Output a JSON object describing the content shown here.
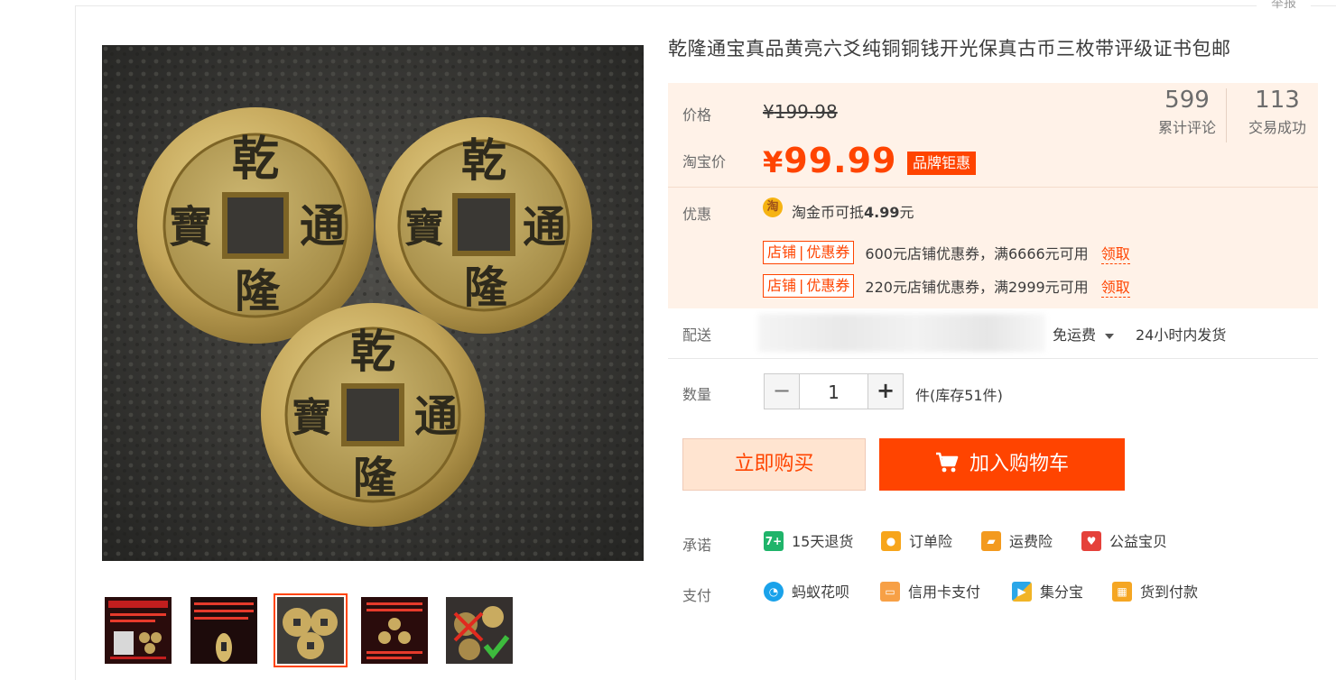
{
  "report_label": "举报",
  "product": {
    "title": "乾隆通宝真品黄亮六爻纯铜铜钱开光保真古币三枚带评级证书包邮",
    "coin_chars": {
      "top": "乾",
      "right": "通",
      "bottom": "隆",
      "left": "寶"
    }
  },
  "price": {
    "price_label": "价格",
    "original_price_yen": "¥",
    "original_price": "199.98",
    "taobao_label": "淘宝价",
    "taobao_price_yen": "¥",
    "taobao_price": "99.99",
    "brand_badge": "品牌钜惠",
    "reviews_count": "599",
    "reviews_label": "累计评论",
    "trades_count": "113",
    "trades_label": "交易成功"
  },
  "promo": {
    "label": "优惠",
    "gold_icon": "淘",
    "gold_text": "淘金币可抵",
    "gold_amount": "4.99",
    "gold_unit": "元",
    "coupons": [
      {
        "tag_a": "店铺",
        "tag_sep": "|",
        "tag_b": "优惠券",
        "text": "600元店铺优惠券，满6666元可用",
        "link": "领取"
      },
      {
        "tag_a": "店铺",
        "tag_sep": "|",
        "tag_b": "优惠券",
        "text": "220元店铺优惠券，满2999元可用",
        "link": "领取"
      }
    ]
  },
  "delivery": {
    "label": "配送",
    "free_shipping": "免运费",
    "ship_time": "24小时内发货"
  },
  "quantity": {
    "label": "数量",
    "minus": "−",
    "value": "1",
    "plus": "+",
    "stock": "件(库存51件)"
  },
  "actions": {
    "buy_now": "立即购买",
    "add_to_cart": "加入购物车"
  },
  "promises": {
    "label": "承诺",
    "items": [
      "15天退货",
      "订单险",
      "运费险",
      "公益宝贝"
    ]
  },
  "payment": {
    "label": "支付",
    "items": [
      "蚂蚁花呗",
      "信用卡支付",
      "集分宝",
      "货到付款"
    ]
  },
  "colors": {
    "accent": "#ff4400",
    "price_bg": "#fff2e8",
    "buy_bg": "#ffe4d0"
  }
}
